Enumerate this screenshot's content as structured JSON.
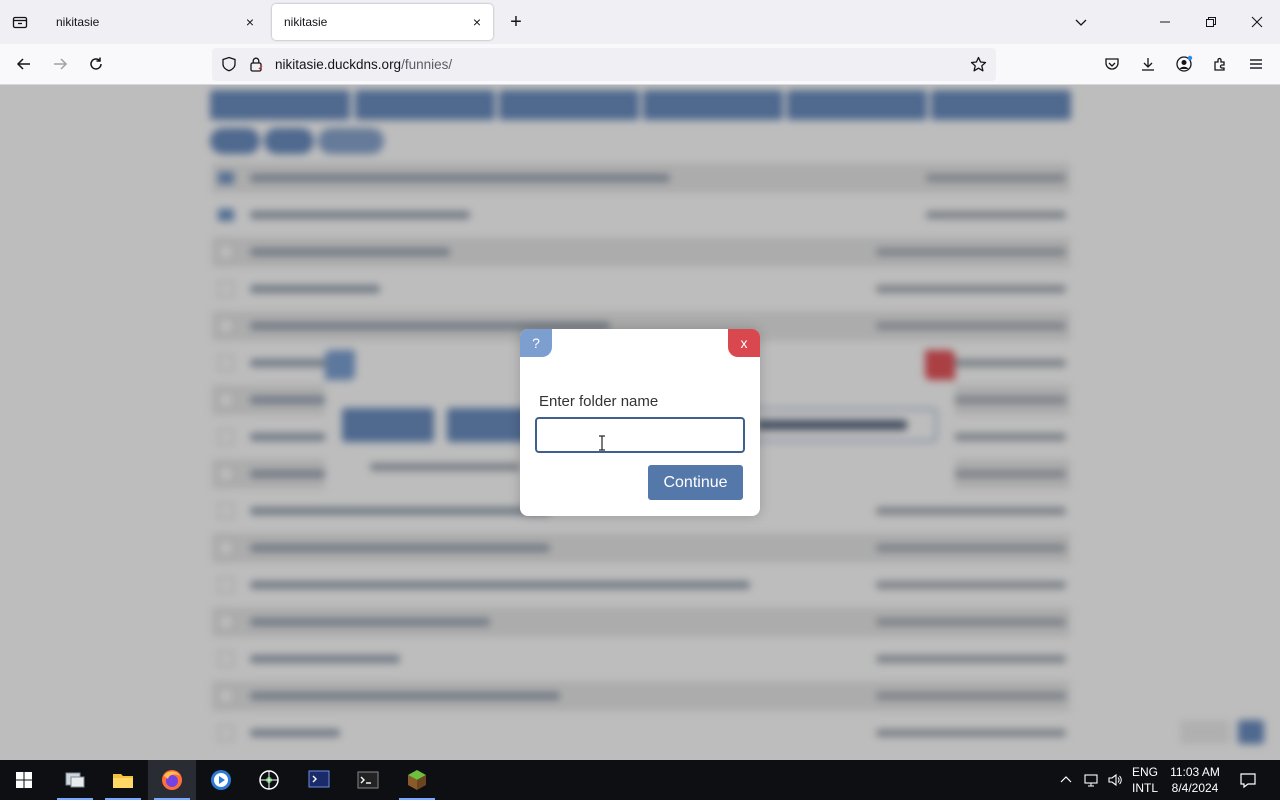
{
  "browser": {
    "tabs": [
      {
        "title": "nikitasie",
        "active": false
      },
      {
        "title": "nikitasie",
        "active": true
      }
    ],
    "url_domain": "nikitasie.duckdns.org",
    "url_path": "/funnies/",
    "close_symbol": "×",
    "new_tab_symbol": "+"
  },
  "modal": {
    "help_label": "?",
    "close_label": "x",
    "prompt": "Enter folder name",
    "input_value": "",
    "input_placeholder": "",
    "continue_label": "Continue"
  },
  "taskbar": {
    "language_line1": "ENG",
    "language_line2": "INTL",
    "time": "11:03 AM",
    "date": "8/4/2024"
  },
  "colors": {
    "accent": "#5578ab",
    "close_red": "#d9474f",
    "help_blue": "#7d9fcf"
  }
}
